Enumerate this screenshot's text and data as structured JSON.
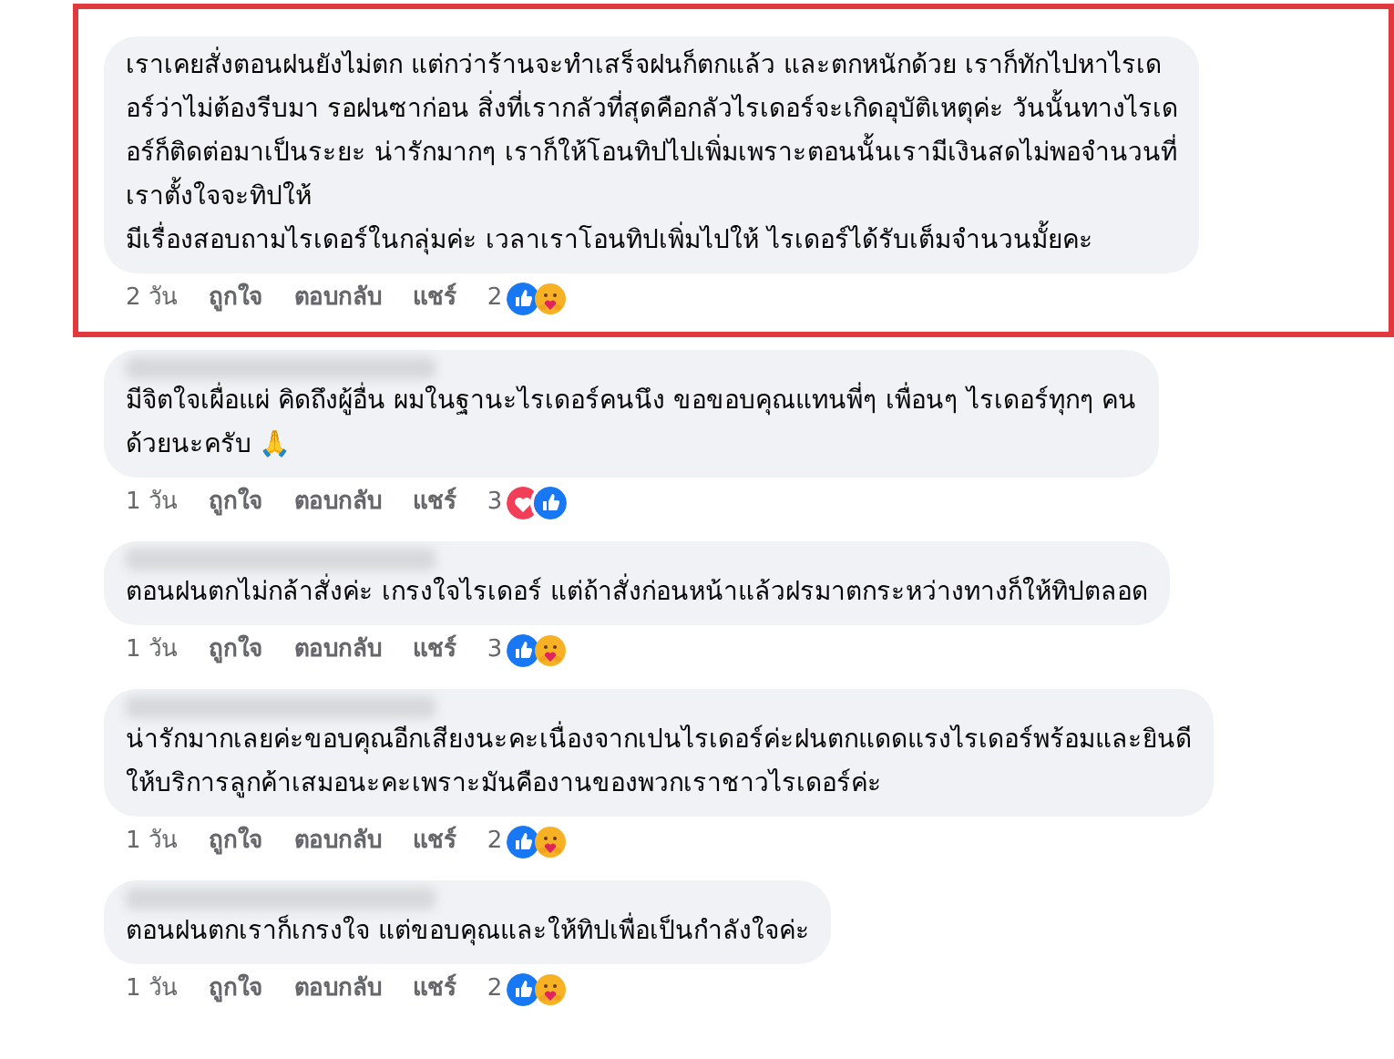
{
  "comments": [
    {
      "highlighted": true,
      "name_hidden": false,
      "lines": [
        "เราเคยสั่งตอนฝนยังไม่ตก แต่กว่าร้านจะทำเสร็จฝนก็ตกแล้ว และตกหนักด้วย เราก็ทักไปหาไรเด",
        "อร์ว่าไม่ต้องรีบมา รอฝนซาก่อน สิ่งที่เรากลัวที่สุดคือกลัวไรเดอร์จะเกิดอุบัติเหตุค่ะ วันนั้นทางไรเด",
        "อร์ก็ติดต่อมาเป็นระยะ น่ารักมากๆ เราก็ให้โอนทิปไปเพิ่มเพราะตอนนั้นเรามีเงินสดไม่พอจำนวนที่",
        "เราตั้งใจจะทิปให้",
        "มีเรื่องสอบถามไรเดอร์ในกลุ่มค่ะ เวลาเราโอนทิปเพิ่มไปให้ ไรเดอร์ได้รับเต็มจำนวนมั้ยคะ"
      ],
      "time": "2 วัน",
      "like": "ถูกใจ",
      "reply": "ตอบกลับ",
      "share": "แชร์",
      "count": "2",
      "reactions": [
        {
          "kind": "like"
        },
        {
          "kind": "care"
        }
      ]
    },
    {
      "highlighted": false,
      "name_hidden": true,
      "lines": [
        "มีจิตใจเผื่อแผ่ คิดถึงผู้อื่น ผมในฐานะไรเดอร์คนนึง ขอขอบคุณแทนพี่ๆ เพื่อนๆ ไรเดอร์ทุกๆ คน",
        "ด้วยนะครับ"
      ],
      "emoji": "🙏",
      "time": "1 วัน",
      "like": "ถูกใจ",
      "reply": "ตอบกลับ",
      "share": "แชร์",
      "count": "3",
      "reactions": [
        {
          "kind": "love"
        },
        {
          "kind": "like"
        }
      ]
    },
    {
      "highlighted": false,
      "name_hidden": true,
      "lines": [
        "ตอนฝนตกไม่กล้าสั่งค่ะ เกรงใจไรเดอร์ แต่ถ้าสั่งก่อนหน้าแล้วฝรมาตกระหว่างทางก็ให้ทิปตลอด"
      ],
      "time": "1 วัน",
      "like": "ถูกใจ",
      "reply": "ตอบกลับ",
      "share": "แชร์",
      "count": "3",
      "reactions": [
        {
          "kind": "like"
        },
        {
          "kind": "care"
        }
      ]
    },
    {
      "highlighted": false,
      "name_hidden": true,
      "lines": [
        "น่ารักมากเลยค่ะขอบคุณอีกเสียงนะคะเนื่องจากเปนไรเดอร์ค่ะฝนตกแดดแรงไรเดอร์พร้อมและยินดี",
        "ให้บริการลูกค้าเสมอนะคะเพราะมันคืองานของพวกเราชาวไรเดอร์ค่ะ"
      ],
      "time": "1 วัน",
      "like": "ถูกใจ",
      "reply": "ตอบกลับ",
      "share": "แชร์",
      "count": "2",
      "reactions": [
        {
          "kind": "like"
        },
        {
          "kind": "care"
        }
      ]
    },
    {
      "highlighted": false,
      "name_hidden": true,
      "lines": [
        "ตอนฝนตกเราก็เกรงใจ แต่ขอบคุณและให้ทิปเพื่อเป็นกำลังใจค่ะ"
      ],
      "time": "1 วัน",
      "like": "ถูกใจ",
      "reply": "ตอบกลับ",
      "share": "แชร์",
      "count": "2",
      "reactions": [
        {
          "kind": "like"
        },
        {
          "kind": "care"
        }
      ]
    }
  ]
}
